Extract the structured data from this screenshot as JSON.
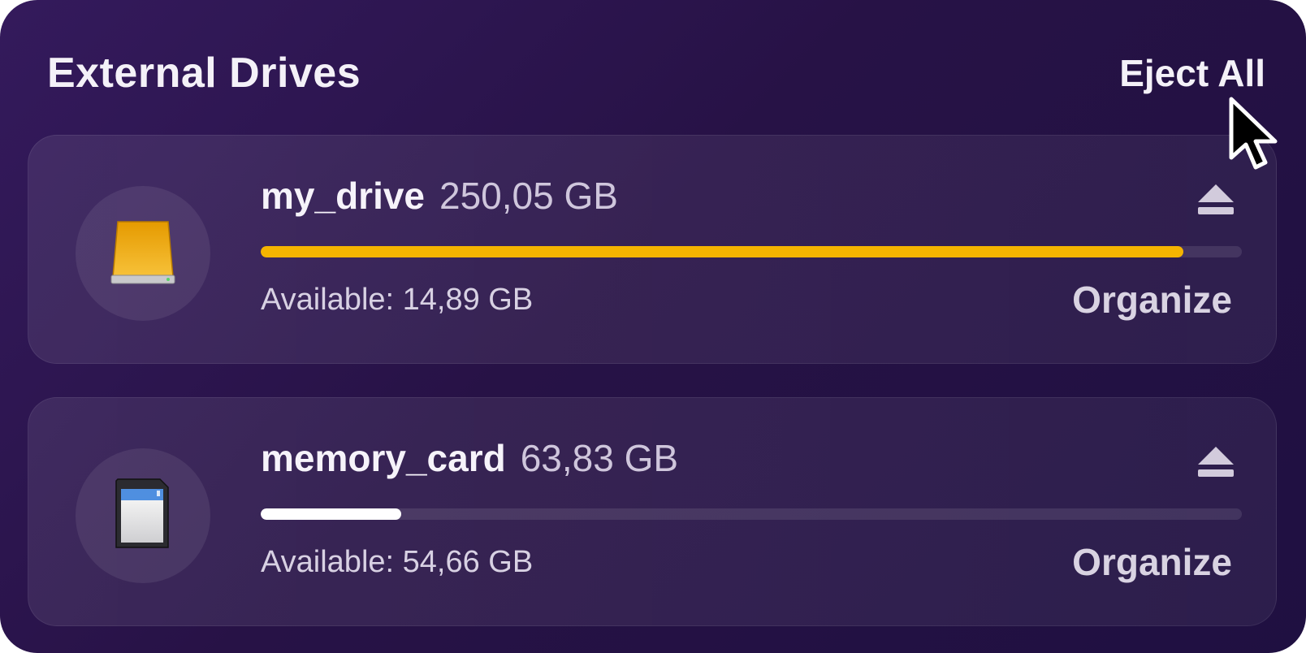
{
  "header": {
    "title": "External Drives",
    "eject_all_label": "Eject All"
  },
  "drives": [
    {
      "name": "my_drive",
      "size": "250,05 GB",
      "available": "Available: 14,89 GB",
      "organize_label": "Organize",
      "used_fraction": 0.94,
      "bar_color": "#f5b400",
      "icon": "external-hard-drive-icon"
    },
    {
      "name": "memory_card",
      "size": "63,83 GB",
      "available": "Available: 54,66 GB",
      "organize_label": "Organize",
      "used_fraction": 0.143,
      "bar_color": "#ffffff",
      "icon": "sd-card-icon"
    }
  ],
  "colors": {
    "background": "#2a1550",
    "accent_yellow": "#f5b400"
  }
}
